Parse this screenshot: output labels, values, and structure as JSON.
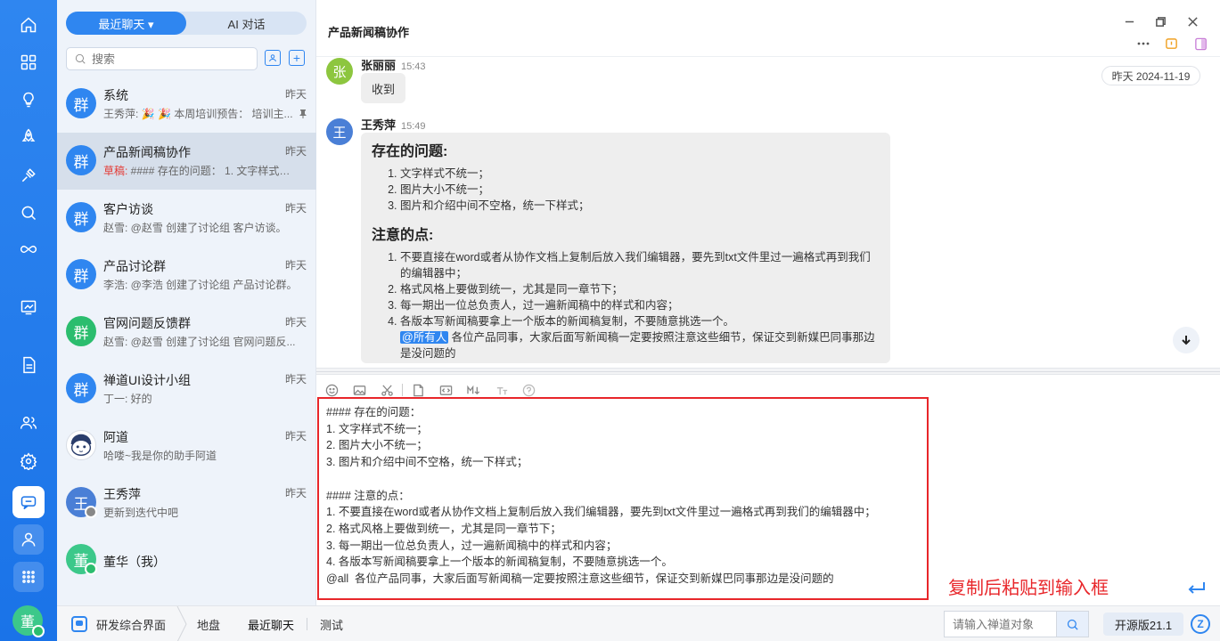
{
  "colors": {
    "accent": "#2f86f0",
    "highlight_red": "#e8262a",
    "draft_red": "#e43b35",
    "online_green": "#2bbd6e"
  },
  "rail": {
    "icons": [
      "home-icon",
      "apps-icon",
      "lightbulb-icon",
      "rocket-icon",
      "sprint-icon",
      "search-icon",
      "infinity-icon",
      "kanban-icon",
      "document-icon",
      "team-icon",
      "settings-icon",
      "chat-icon",
      "user-icon",
      "grid-icon"
    ],
    "avatar_text": "董"
  },
  "list": {
    "tabs": [
      {
        "label": "最近聊天 ▾"
      },
      {
        "label": "AI 对话"
      }
    ],
    "search": {
      "placeholder": "搜索"
    },
    "conversations": [
      {
        "name": "系统",
        "time": "昨天",
        "avatar": "群",
        "color": "#2f86f0",
        "draft": "",
        "preview": "王秀萍: 🎉 🎉 本周培训预告： 培训主...",
        "pinned": true
      },
      {
        "name": "产品新闻稿协作",
        "time": "昨天",
        "avatar": "群",
        "color": "#2f86f0",
        "draft": "草稿:",
        "preview": " #### 存在的问题： 1. 文字样式不...",
        "selected": true
      },
      {
        "name": "客户访谈",
        "time": "昨天",
        "avatar": "群",
        "color": "#2f86f0",
        "draft": "",
        "preview": "赵雪: @赵雪 创建了讨论组 客户访谈。"
      },
      {
        "name": "产品讨论群",
        "time": "昨天",
        "avatar": "群",
        "color": "#2f86f0",
        "draft": "",
        "preview": "李浩: @李浩 创建了讨论组 产品讨论群。"
      },
      {
        "name": "官网问题反馈群",
        "time": "昨天",
        "avatar": "群",
        "color": "#2bbd6e",
        "draft": "",
        "preview": "赵雪: @赵雪 创建了讨论组 官网问题反..."
      },
      {
        "name": "禅道UI设计小组",
        "time": "昨天",
        "avatar": "群",
        "color": "#2f86f0",
        "draft": "",
        "preview": "丁一: 好的"
      },
      {
        "name": "阿道",
        "time": "昨天",
        "avatar": "",
        "color": "#ffffff",
        "draft": "",
        "preview": "哈喽~我是你的助手阿道"
      },
      {
        "name": "王秀萍",
        "time": "昨天",
        "avatar": "王",
        "color": "#4a7fd6",
        "draft": "",
        "preview": "更新到迭代中吧"
      },
      {
        "name": "董华（我）",
        "time": "",
        "avatar": "董",
        "color": "#3cc88a",
        "draft": "",
        "preview": ""
      }
    ]
  },
  "chat": {
    "title": "产品新闻稿协作",
    "date_divider": "昨天 2024-11-19",
    "messages": [
      {
        "avatar": "张",
        "sender": "张丽丽",
        "time": "15:43",
        "text": "收到"
      },
      {
        "avatar": "王",
        "sender": "王秀萍",
        "time": "15:49",
        "h1": "存在的问题:",
        "list1": [
          "文字样式不统一；",
          "图片大小不统一；",
          "图片和介绍中间不空格，统一下样式；"
        ],
        "h2": "注意的点:",
        "list2": [
          "不要直接在word或者从协作文档上复制后放入我们编辑器，要先到txt文件里过一遍格式再到我们的编辑器中；",
          "格式风格上要做到统一，尤其是同一章节下；",
          "每一期出一位总负责人，过一遍新闻稿中的样式和内容；",
          "各版本写新闻稿要拿上一个版本的新闻稿复制，不要随意挑选一个。"
        ],
        "mention": "@所有人",
        "tail": " 各位产品同事，大家后面写新闻稿一定要按照注意这些细节，保证交到新媒巴同事那边是没问题的"
      }
    ],
    "toolbar": [
      "emoji-icon",
      "image-icon",
      "scissors-icon",
      "file-icon",
      "code-icon",
      "markdown-icon",
      "font-size-icon",
      "help-icon"
    ],
    "editor_text": "#### 存在的问题：\n1. 文字样式不统一；\n2. 图片大小不统一；\n3. 图片和介绍中间不空格，统一下样式；\n\n#### 注意的点：\n1. 不要直接在word或者从协作文档上复制后放入我们编辑器，要先到txt文件里过一遍格式再到我们的编辑器中；\n2. 格式风格上要做到统一，尤其是同一章节下；\n3. 每一期出一位总负责人，过一遍新闻稿中的样式和内容；\n4. 各版本写新闻稿要拿上一个版本的新闻稿复制，不要随意挑选一个。\n@all  各位产品同事，大家后面写新闻稿一定要按照注意这些细节，保证交到新媒巴同事那边是没问题的",
    "annotation": "复制后粘贴到输入框"
  },
  "bottom": {
    "app_name": "研发综合界面",
    "items": [
      "地盘",
      "最近聊天",
      "测试"
    ],
    "search_placeholder": "请输入禅道对象",
    "version": "开源版21.1"
  }
}
